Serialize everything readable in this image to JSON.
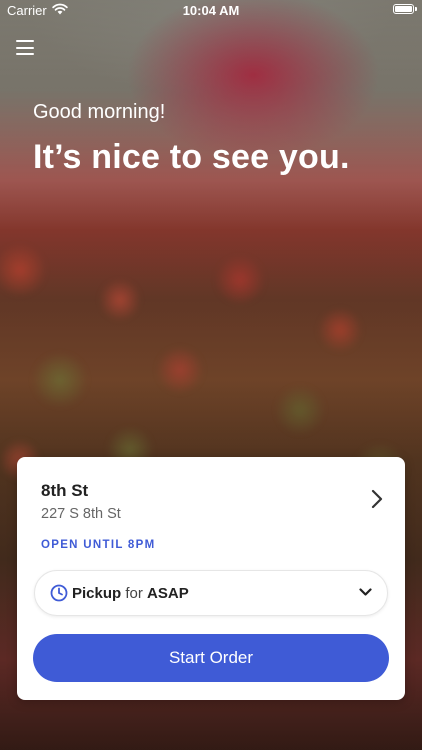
{
  "status_bar": {
    "carrier": "Carrier",
    "time": "10:04 AM"
  },
  "hero": {
    "greeting": "Good morning!",
    "headline": "It’s nice to see you."
  },
  "location": {
    "name": "8th St",
    "address": "227 S 8th St",
    "hours": "OPEN UNTIL 8PM"
  },
  "order_mode": {
    "mode": "Pickup",
    "connector": "for",
    "time": "ASAP"
  },
  "actions": {
    "start_order": "Start Order"
  },
  "colors": {
    "accent": "#3f5bd6"
  },
  "icons": [
    "wifi-icon",
    "battery-icon",
    "menu-icon",
    "chevron-right-icon",
    "clock-icon",
    "chevron-down-icon"
  ]
}
